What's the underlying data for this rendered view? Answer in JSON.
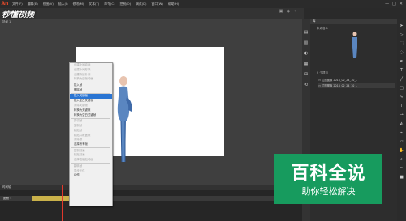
{
  "app": {
    "logo": "An"
  },
  "menubar": {
    "items": [
      "文件(F)",
      "编辑(E)",
      "视图(V)",
      "插入(I)",
      "修改(M)",
      "文本(T)",
      "命令(C)",
      "控制(O)",
      "调试(D)",
      "窗口(W)",
      "帮助(H)"
    ],
    "window_controls": [
      "—",
      "□",
      "✕"
    ]
  },
  "document": {
    "tab": "未命名-1",
    "scene": "场景 1"
  },
  "context_menu": {
    "items": [
      {
        "label": "创建补间动画",
        "state": "disabled"
      },
      {
        "label": "创建补间形状",
        "state": "disabled"
      },
      {
        "label": "创建传统补间",
        "state": "disabled"
      },
      {
        "label": "转换为逐帧动画",
        "state": "disabled"
      },
      {
        "sep": true
      },
      {
        "label": "插入帧",
        "state": "normal"
      },
      {
        "label": "删除帧",
        "state": "normal"
      },
      {
        "sep": true
      },
      {
        "label": "插入关键帧",
        "state": "highlighted"
      },
      {
        "label": "插入空白关键帧",
        "state": "normal"
      },
      {
        "label": "清除关键帧",
        "state": "disabled"
      },
      {
        "label": "转换为关键帧",
        "state": "normal"
      },
      {
        "label": "转换为空白关键帧",
        "state": "normal"
      },
      {
        "sep": true
      },
      {
        "label": "剪切帧",
        "state": "disabled"
      },
      {
        "label": "复制帧",
        "state": "disabled"
      },
      {
        "label": "粘贴帧",
        "state": "disabled"
      },
      {
        "label": "粘贴并覆盖帧",
        "state": "disabled"
      },
      {
        "label": "清除帧",
        "state": "disabled"
      },
      {
        "label": "选择所有帧",
        "state": "normal"
      },
      {
        "sep": true
      },
      {
        "label": "复制动画",
        "state": "disabled"
      },
      {
        "label": "粘贴动画",
        "state": "disabled"
      },
      {
        "label": "选择性粘贴动画",
        "state": "disabled"
      },
      {
        "sep": true
      },
      {
        "label": "翻转帧",
        "state": "disabled"
      },
      {
        "label": "同步元件",
        "state": "disabled"
      },
      {
        "label": "动作",
        "state": "normal"
      }
    ]
  },
  "timeline": {
    "header": "时间轴",
    "layer": "图层 1"
  },
  "library": {
    "header": "库",
    "doc_name": "未命名-1",
    "count": "2 个项目",
    "items": [
      "位图图像 2016_02_24_10_..",
      "位图图像 2016_02_24_10_.."
    ]
  },
  "watermark": {
    "top": "秒懂视频",
    "title": "百科全说",
    "subtitle": "助你轻松解决"
  }
}
